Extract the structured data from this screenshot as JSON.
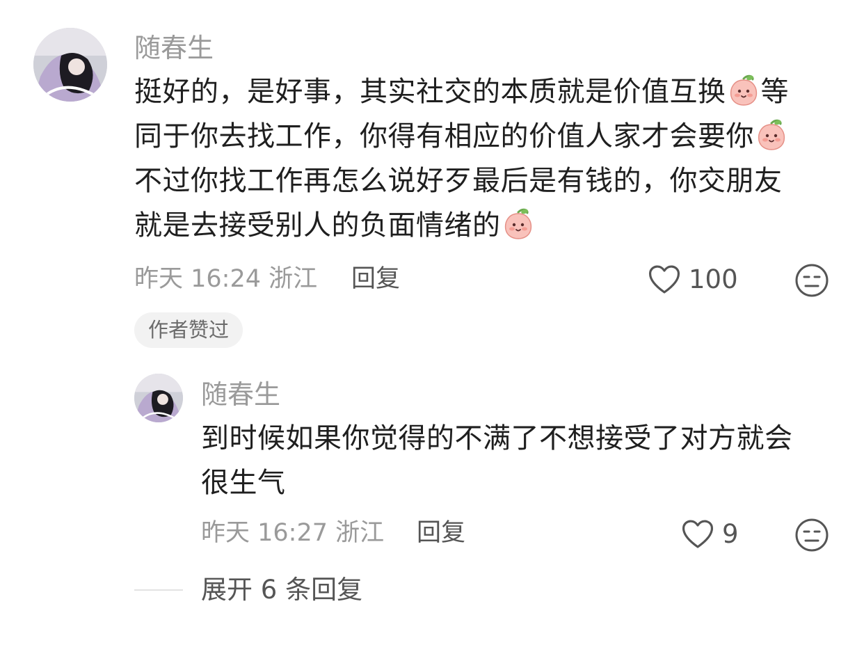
{
  "comment": {
    "username": "随春生",
    "lines": [
      "挺好的，是好事，其实社交的本质就是价值互换",
      "等",
      "同于你去找工作，你得有相应的价值人家才会要你",
      "不过你找工作再怎么说好歹最后是有钱的，你交朋友",
      "就是去接受别人的负面情绪的"
    ],
    "meta": "昨天 16:24 浙江",
    "reply_label": "回复",
    "like_count": "100",
    "author_badge": "作者赞过"
  },
  "reply": {
    "username": "随春生",
    "lines": [
      "到时候如果你觉得的不满了不想接受了对方就会",
      "很生气"
    ],
    "meta": "昨天 16:27 浙江",
    "reply_label": "回复",
    "like_count": "9"
  },
  "expand": {
    "label": "展开 6 条回复"
  },
  "icons": {
    "emoji": "peach-face-emoji",
    "like": "heart-icon",
    "dislike": "meh-face-icon"
  },
  "colors": {
    "muted_text": "#9a9a9a",
    "body_text": "#1f1f1f",
    "badge_bg": "#f2f2f2",
    "emoji_pink": "#f7b3ad"
  }
}
